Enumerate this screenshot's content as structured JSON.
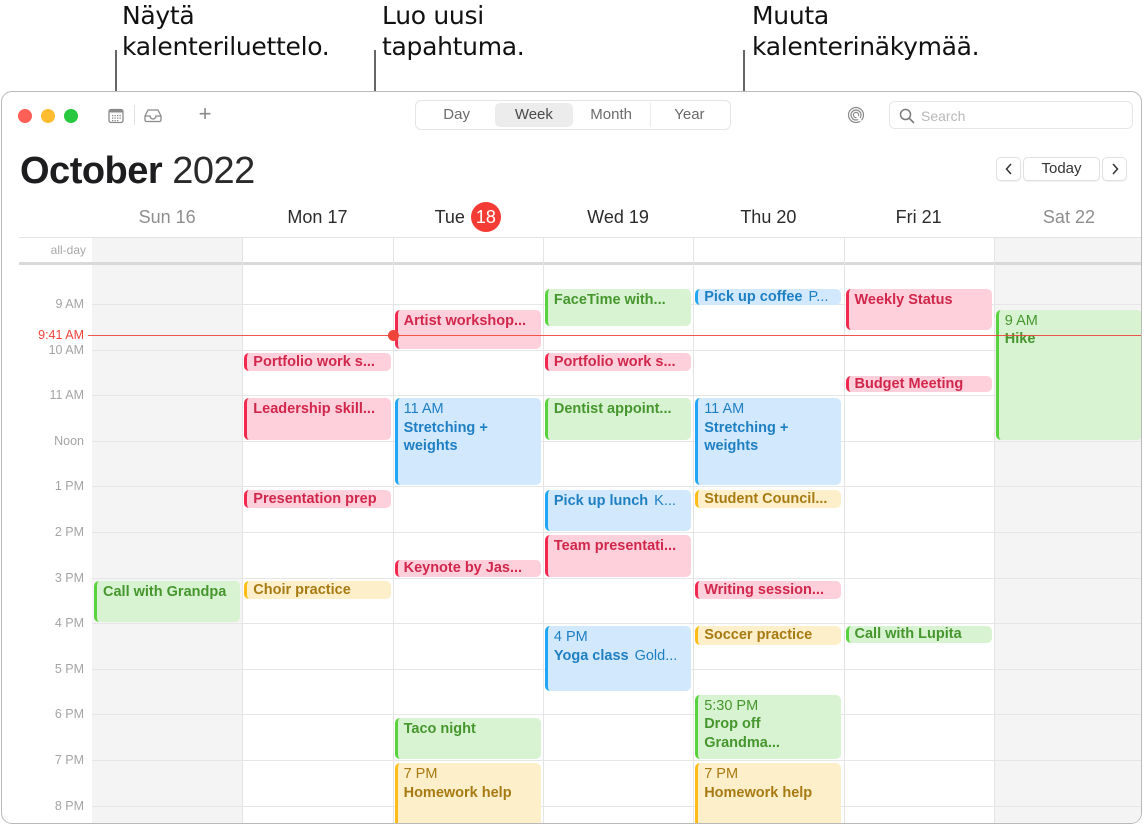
{
  "callouts": [
    {
      "id": "show-calendar-list",
      "line1": "Näytä",
      "line2": "kalenteriluettelo."
    },
    {
      "id": "create-new-event",
      "line1": "Luo uusi",
      "line2": "tapahtuma."
    },
    {
      "id": "change-calendar-view",
      "line1": "Muuta",
      "line2": "kalenterinäkymää."
    }
  ],
  "toolbar": {
    "calendar_list_icon": "calendar-list-icon",
    "inbox_icon": "inbox-tray-icon",
    "add_icon": "plus-icon",
    "add_label": "+",
    "view_tabs": [
      {
        "label": "Day",
        "active": false
      },
      {
        "label": "Week",
        "active": true
      },
      {
        "label": "Month",
        "active": false
      },
      {
        "label": "Year",
        "active": false
      }
    ],
    "airdrop_icon": "airdrop-icon",
    "search_placeholder": "Search",
    "search_value": ""
  },
  "header": {
    "month": "October",
    "year": "2022",
    "prev_label": "‹",
    "today_label": "Today",
    "next_label": "›"
  },
  "days": [
    {
      "label": "Sun 16",
      "weekend": true,
      "today": false
    },
    {
      "label": "Mon 17",
      "weekend": false,
      "today": false
    },
    {
      "label": "Tue",
      "date": "18",
      "weekend": false,
      "today": true
    },
    {
      "label": "Wed 19",
      "weekend": false,
      "today": false
    },
    {
      "label": "Thu 20",
      "weekend": false,
      "today": false
    },
    {
      "label": "Fri 21",
      "weekend": false,
      "today": false
    },
    {
      "label": "Sat 22",
      "weekend": true,
      "today": false
    }
  ],
  "all_day_label": "all-day",
  "hours": [
    "9 AM",
    "10 AM",
    "11 AM",
    "Noon",
    "1 PM",
    "2 PM",
    "3 PM",
    "4 PM",
    "5 PM",
    "6 PM",
    "7 PM",
    "8 PM"
  ],
  "now": {
    "label": "9:41 AM",
    "time": 9.683
  },
  "colors": {
    "red": "#f2294f",
    "green": "#59d33d",
    "blue": "#21a6f5",
    "yellow": "#fdbc17",
    "today": "#f43c35"
  },
  "events": [
    {
      "day": 0,
      "start": 15.05,
      "end": 16.0,
      "color": "green",
      "title": "Call with Grandpa"
    },
    {
      "day": 1,
      "start": 10.05,
      "end": 10.5,
      "color": "red",
      "title": "Portfolio work s..."
    },
    {
      "day": 1,
      "start": 11.05,
      "end": 12.0,
      "color": "red",
      "title": "Leadership skill..."
    },
    {
      "day": 1,
      "start": 13.05,
      "end": 13.5,
      "color": "red",
      "title": "Presentation prep"
    },
    {
      "day": 1,
      "start": 15.05,
      "end": 15.5,
      "color": "yellow",
      "title": "Choir practice"
    },
    {
      "day": 2,
      "start": 9.1,
      "end": 10.0,
      "color": "red",
      "title": "Artist workshop..."
    },
    {
      "day": 2,
      "start": 11.05,
      "end": 13.0,
      "color": "blue",
      "time": "11 AM",
      "title": "Stretching + weights",
      "wrap": true
    },
    {
      "day": 2,
      "start": 14.6,
      "end": 15.0,
      "color": "red",
      "title": "Keynote by Jas..."
    },
    {
      "day": 2,
      "start": 18.05,
      "end": 19.0,
      "color": "green",
      "title": "Taco night"
    },
    {
      "day": 2,
      "start": 19.05,
      "end": 20.5,
      "color": "yellow",
      "time": "7 PM",
      "title": "Homework help"
    },
    {
      "day": 3,
      "start": 8.65,
      "end": 9.5,
      "color": "green",
      "title": "FaceTime with..."
    },
    {
      "day": 3,
      "start": 10.05,
      "end": 10.5,
      "color": "red",
      "title": "Portfolio work s..."
    },
    {
      "day": 3,
      "start": 11.05,
      "end": 12.0,
      "color": "green",
      "title": "Dentist appoint..."
    },
    {
      "day": 3,
      "start": 13.05,
      "end": 14.0,
      "color": "blue",
      "title": "Pick up lunch",
      "location": "K..."
    },
    {
      "day": 3,
      "start": 14.05,
      "end": 15.0,
      "color": "red",
      "title": "Team presentati..."
    },
    {
      "day": 3,
      "start": 16.05,
      "end": 17.5,
      "color": "blue",
      "time": "4 PM",
      "title": "Yoga class",
      "location": "Gold..."
    },
    {
      "day": 4,
      "start": 8.65,
      "end": 9.05,
      "color": "blue",
      "title": "Pick up coffee",
      "location": "P..."
    },
    {
      "day": 4,
      "start": 11.05,
      "end": 13.0,
      "color": "blue",
      "time": "11 AM",
      "title": "Stretching + weights",
      "wrap": true
    },
    {
      "day": 4,
      "start": 13.05,
      "end": 13.5,
      "color": "yellow",
      "title": "Student Council..."
    },
    {
      "day": 4,
      "start": 15.05,
      "end": 15.5,
      "color": "red",
      "title": "Writing session..."
    },
    {
      "day": 4,
      "start": 16.05,
      "end": 16.5,
      "color": "yellow",
      "title": "Soccer practice"
    },
    {
      "day": 4,
      "start": 17.55,
      "end": 19.0,
      "color": "green",
      "time": "5:30 PM",
      "title": "Drop off Grandma...",
      "wrap": true
    },
    {
      "day": 4,
      "start": 19.05,
      "end": 20.5,
      "color": "yellow",
      "time": "7 PM",
      "title": "Homework help"
    },
    {
      "day": 5,
      "start": 8.65,
      "end": 9.6,
      "color": "red",
      "title": "Weekly Status"
    },
    {
      "day": 5,
      "start": 10.55,
      "end": 10.95,
      "color": "red",
      "title": "Budget Meeting"
    },
    {
      "day": 5,
      "start": 16.05,
      "end": 16.45,
      "color": "green",
      "title": "Call with Lupita"
    },
    {
      "day": 6,
      "start": 9.1,
      "end": 12.0,
      "color": "green",
      "time": "9 AM",
      "title": "Hike",
      "wrap": true
    }
  ]
}
